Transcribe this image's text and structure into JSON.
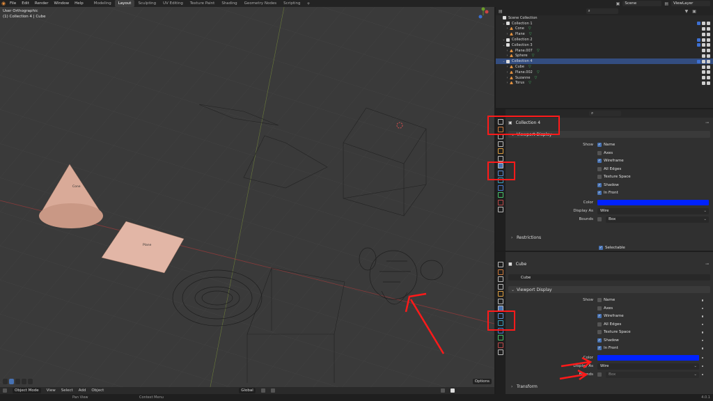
{
  "menu": [
    "File",
    "Edit",
    "Render",
    "Window",
    "Help"
  ],
  "workspaces": [
    "Modeling",
    "Layout",
    "Sculpting",
    "UV Editing",
    "Texture Paint",
    "Shading",
    "Geometry Nodes",
    "Scripting"
  ],
  "active_workspace": "Layout",
  "scene_name": "Scene",
  "view_layer": "ViewLayer",
  "viewport": {
    "view_name": "User Orthographic",
    "context": "(1) Collection 4 | Cube",
    "object_labels": {
      "cone": "Cone",
      "plane": "Plane"
    },
    "mode": "Object Mode",
    "menus": [
      "View",
      "Select",
      "Add",
      "Object"
    ],
    "orientation": "Global",
    "options": "Options"
  },
  "statusbar": {
    "pan": "Pan View",
    "context": "Context Menu",
    "version": "4.0.1"
  },
  "outliner": {
    "rows": [
      {
        "label": "Scene Collection",
        "level": 0,
        "kind": "scene"
      },
      {
        "label": "Collection 1",
        "level": 1,
        "kind": "collection"
      },
      {
        "label": "Cone",
        "level": 2,
        "kind": "mesh",
        "mod": true
      },
      {
        "label": "Plane",
        "level": 2,
        "kind": "mesh",
        "mod": true
      },
      {
        "label": "Collection 2",
        "level": 1,
        "kind": "collection"
      },
      {
        "label": "Collection 3",
        "level": 1,
        "kind": "collection"
      },
      {
        "label": "Plane.007",
        "level": 2,
        "kind": "mesh",
        "mod": true
      },
      {
        "label": "Sphere",
        "level": 2,
        "kind": "mesh",
        "mod": true
      },
      {
        "label": "Collection 4",
        "level": 1,
        "kind": "collection",
        "selected": true
      },
      {
        "label": "Cube",
        "level": 2,
        "kind": "mesh",
        "mod": true
      },
      {
        "label": "Plane.002",
        "level": 2,
        "kind": "mesh",
        "mod": true
      },
      {
        "label": "Suzanne",
        "level": 2,
        "kind": "mesh",
        "mod": true
      },
      {
        "label": "Torus",
        "level": 2,
        "kind": "mesh",
        "mod": true
      }
    ]
  },
  "collection_props": {
    "name": "Collection 4",
    "section": "Viewport Display",
    "show_label": "Show",
    "checks": [
      {
        "label": "Name",
        "on": true
      },
      {
        "label": "Axes",
        "on": false
      },
      {
        "label": "Wireframe",
        "on": true
      },
      {
        "label": "All Edges",
        "on": false
      },
      {
        "label": "Texture Space",
        "on": false
      },
      {
        "label": "Shadow",
        "on": true
      },
      {
        "label": "In Front",
        "on": true
      }
    ],
    "color_label": "Color",
    "color": "#0022ff",
    "display_as_label": "Display As",
    "display_as": "Wire",
    "bounds_label": "Bounds",
    "bounds": "Box",
    "restrictions": "Restrictions",
    "selectable": "Selectable"
  },
  "object_props": {
    "name": "Cube",
    "data_name": "Cube",
    "section": "Viewport Display",
    "show_label": "Show",
    "checks": [
      {
        "label": "Name",
        "on": false
      },
      {
        "label": "Axes",
        "on": false
      },
      {
        "label": "Wireframe",
        "on": true
      },
      {
        "label": "All Edges",
        "on": false
      },
      {
        "label": "Texture Space",
        "on": false
      },
      {
        "label": "Shadow",
        "on": true
      },
      {
        "label": "In Front",
        "on": true
      }
    ],
    "color_label": "Color",
    "color": "#0022ff",
    "display_as_label": "Display As",
    "display_as": "Wire",
    "bounds_label": "Bounds",
    "bounds": "Box",
    "transform": "Transform"
  }
}
